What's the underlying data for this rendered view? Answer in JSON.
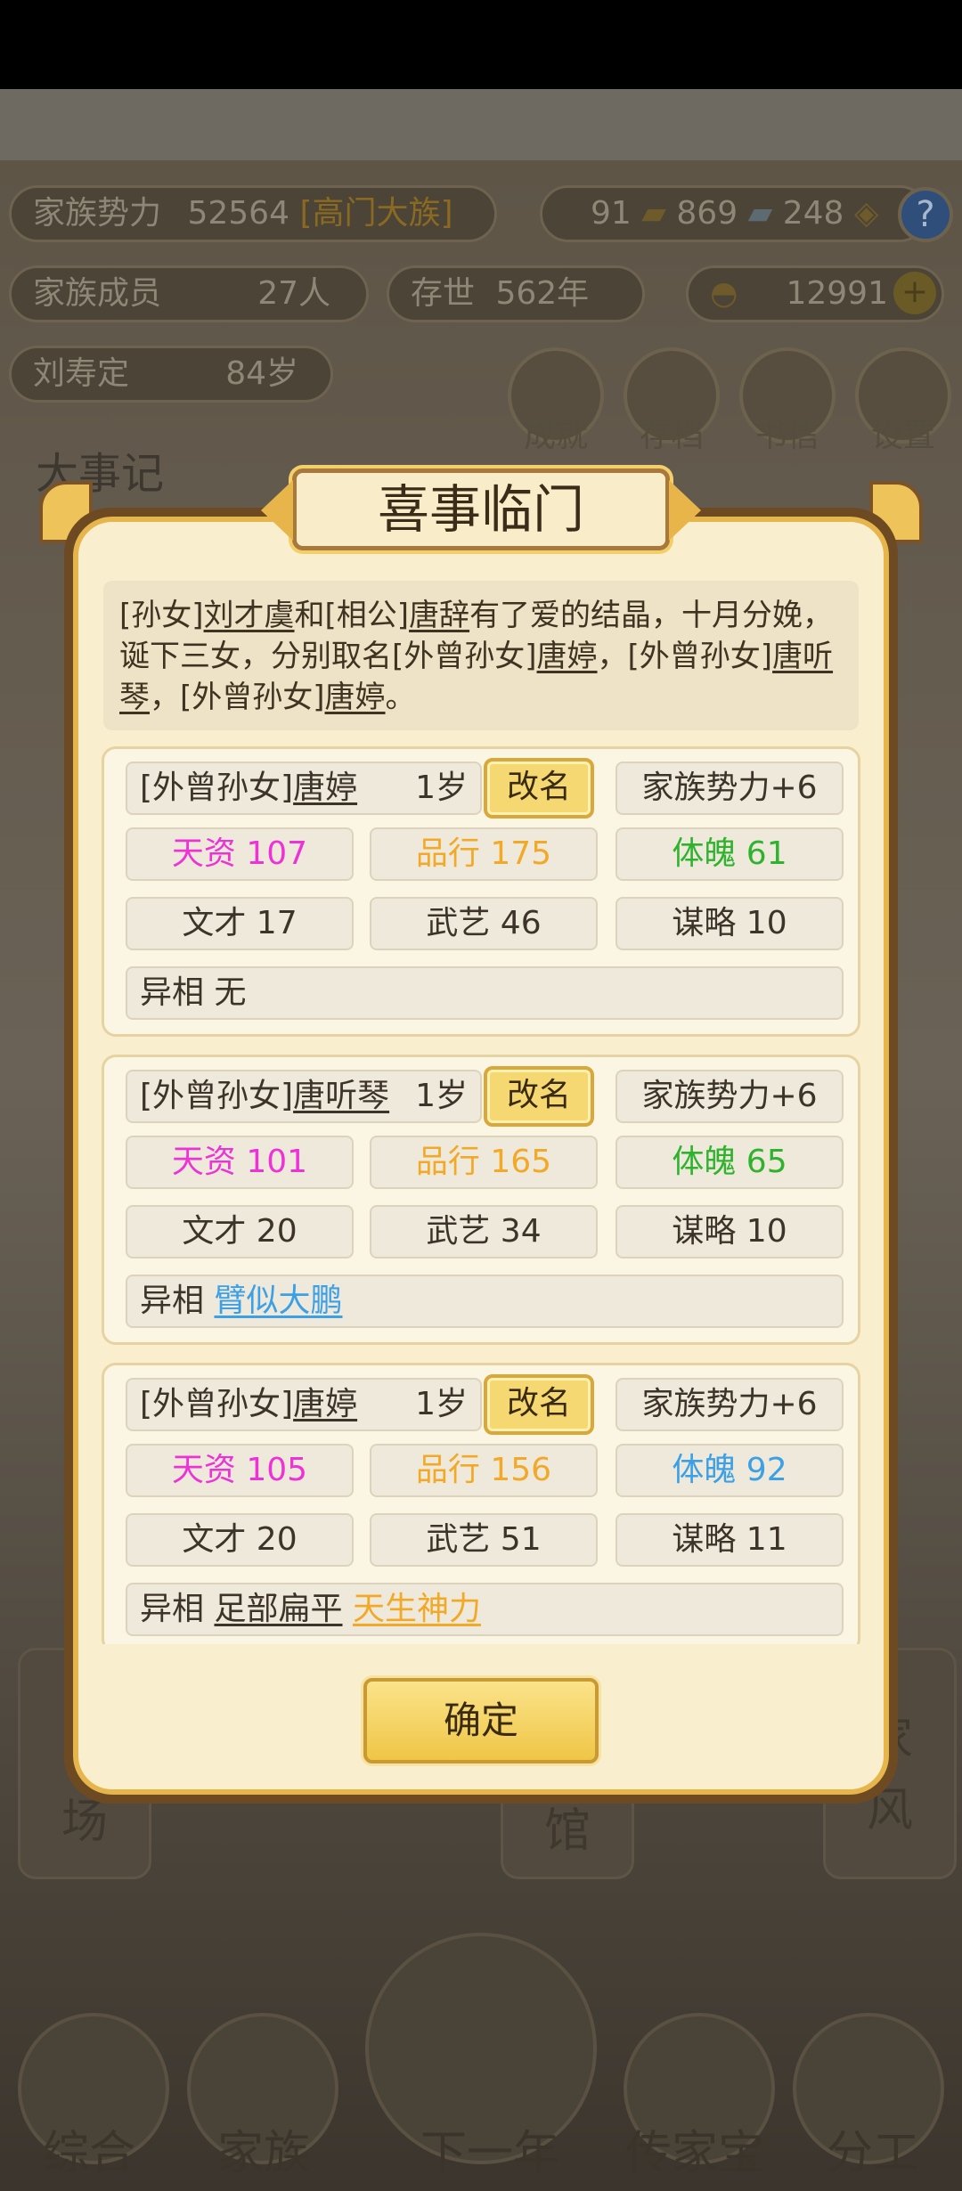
{
  "background": {
    "power_label": "家族势力",
    "power_value": "52564",
    "power_rank": "[高门大族]",
    "res1": "91",
    "res2": "869",
    "res3": "248",
    "help_icon": "?",
    "members_label": "家族成员",
    "members_value": "27人",
    "exist_label": "存世",
    "exist_value": "562年",
    "gold_value": "12991",
    "add_icon": "+",
    "leader_name": "刘寿定",
    "leader_age": "84岁",
    "btn_achieve": "成就",
    "btn_save": "存档",
    "btn_letter": "书信",
    "btn_settings": "设置",
    "events_title": "大事记",
    "card_left_1": "场",
    "card_left_2": "馆",
    "card_right_1": "家",
    "card_right_2": "风",
    "tab_general": "综合",
    "tab_family": "家族",
    "tab_next_year": "下一年",
    "tab_heirloom": "传家宝",
    "tab_division": "分工"
  },
  "dialog": {
    "title": "喜事临门",
    "story": {
      "p1": "[孙女]",
      "n1": "刘才虞",
      "p2": "和[相公]",
      "n2": "唐辞",
      "p3": "有了爱的结晶，十月分娩，诞下三女，分别取名[外曾孙女]",
      "n3": "唐婷",
      "p4": "，[外曾孙女]",
      "n4": "唐听琴",
      "p5": "，[外曾孙女]",
      "n5": "唐婷",
      "p6": "。"
    },
    "children": [
      {
        "relation": "[外曾孙女]",
        "name": "唐婷",
        "age": "1岁",
        "rename": "改名",
        "power": "家族势力+6",
        "talent": "天资 107",
        "virtue": "品行 175",
        "physique": "体魄 61",
        "literary": "文才 17",
        "martial": "武艺 46",
        "strategy": "谋略 10",
        "trait_label": "异相",
        "trait_1": "无",
        "trait_2": ""
      },
      {
        "relation": "[外曾孙女]",
        "name": "唐听琴",
        "age": "1岁",
        "rename": "改名",
        "power": "家族势力+6",
        "talent": "天资 101",
        "virtue": "品行 165",
        "physique": "体魄 65",
        "literary": "文才 20",
        "martial": "武艺 34",
        "strategy": "谋略 10",
        "trait_label": "异相",
        "trait_1": "臂似大鹏",
        "trait_2": ""
      },
      {
        "relation": "[外曾孙女]",
        "name": "唐婷",
        "age": "1岁",
        "rename": "改名",
        "power": "家族势力+6",
        "talent": "天资 105",
        "virtue": "品行 156",
        "physique": "体魄 92",
        "literary": "文才 20",
        "martial": "武艺 51",
        "strategy": "谋略 11",
        "trait_label": "异相",
        "trait_1": "足部扁平",
        "trait_2": "天生神力"
      }
    ],
    "confirm": "确定"
  },
  "colors": {
    "talent": "#ee33d6",
    "virtue": "#f2a928",
    "physique_green": "#2fb32f",
    "physique_blue": "#3ba0e6",
    "dialog_bg": "#f9efcf",
    "button_gold": "#f6d873"
  }
}
